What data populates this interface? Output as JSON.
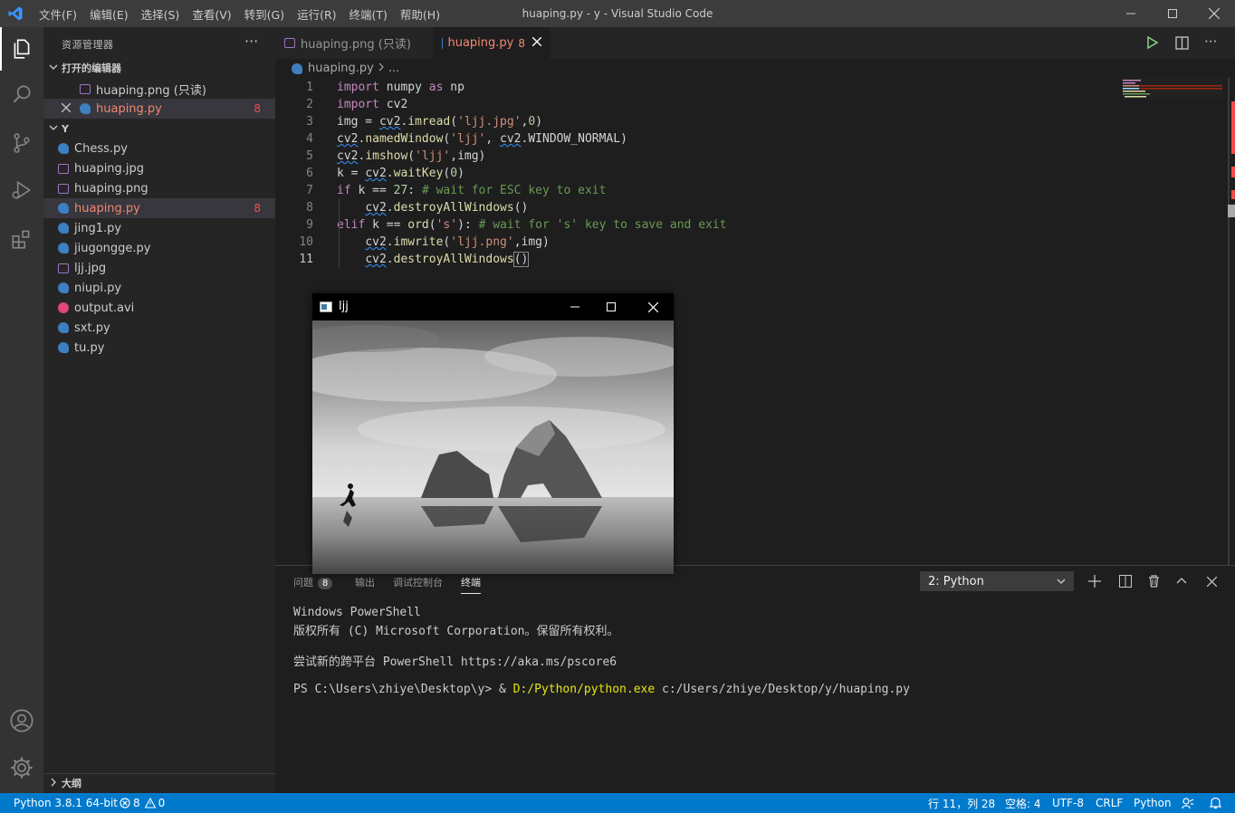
{
  "window": {
    "title": "huaping.py - y - Visual Studio Code",
    "menu": [
      "文件(F)",
      "编辑(E)",
      "选择(S)",
      "查看(V)",
      "转到(G)",
      "运行(R)",
      "终端(T)",
      "帮助(H)"
    ]
  },
  "sidebar": {
    "title": "资源管理器",
    "open_editors_label": "打开的编辑器",
    "open_editors": [
      {
        "name": "huaping.png (只读)",
        "icon": "image-file-icon"
      },
      {
        "name": "huaping.py",
        "icon": "python-file-icon",
        "badge": "8"
      }
    ],
    "folder_label": "Y",
    "files": [
      {
        "name": "Chess.py",
        "icon": "python-file-icon"
      },
      {
        "name": "huaping.jpg",
        "icon": "image-file-icon"
      },
      {
        "name": "huaping.png",
        "icon": "image-file-icon"
      },
      {
        "name": "huaping.py",
        "icon": "python-file-icon",
        "badge": "8"
      },
      {
        "name": "jing1.py",
        "icon": "python-file-icon"
      },
      {
        "name": "jiugongge.py",
        "icon": "python-file-icon"
      },
      {
        "name": "ljj.jpg",
        "icon": "image-file-icon"
      },
      {
        "name": "niupi.py",
        "icon": "python-file-icon"
      },
      {
        "name": "output.avi",
        "icon": "video-file-icon"
      },
      {
        "name": "sxt.py",
        "icon": "python-file-icon"
      },
      {
        "name": "tu.py",
        "icon": "python-file-icon"
      }
    ],
    "outline_label": "大纲"
  },
  "tabs": [
    {
      "label": "huaping.png (只读)"
    },
    {
      "label": "huaping.py",
      "badge": "8"
    }
  ],
  "breadcrumb": {
    "file": "huaping.py",
    "rest": "..."
  },
  "editor": {
    "line_numbers": [
      "1",
      "2",
      "3",
      "4",
      "5",
      "6",
      "7",
      "8",
      "9",
      "10",
      "11"
    ]
  },
  "popup": {
    "title": "ljj"
  },
  "panel": {
    "tabs": [
      "问题",
      "输出",
      "调试控制台",
      "终端"
    ],
    "problems_count": "8",
    "terminal_select": "2: Python",
    "terminal_lines": [
      "Windows PowerShell",
      "版权所有 (C) Microsoft Corporation。保留所有权利。",
      "",
      "尝试新的跨平台 PowerShell https://aka.ms/pscore6",
      ""
    ],
    "prompt": "PS C:\\Users\\zhiye\\Desktop\\y> & ",
    "exe": "D:/Python/python.exe",
    "arg": " c:/Users/zhiye/Desktop/y/huaping.py"
  },
  "status": {
    "interpreter": "Python 3.8.1 64-bit",
    "errors": "8",
    "warnings": "0",
    "position": "行 11，列 28",
    "indent": "空格: 4",
    "encoding": "UTF-8",
    "eol": "CRLF",
    "language": "Python"
  }
}
